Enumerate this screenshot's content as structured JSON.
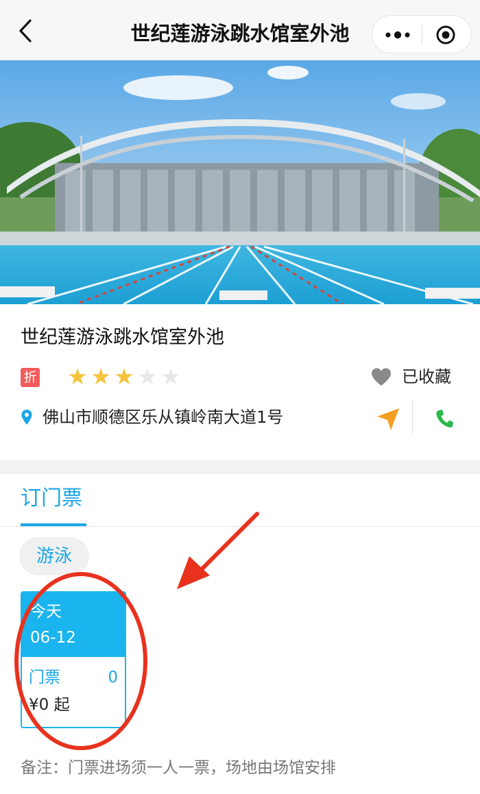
{
  "header": {
    "title": "世纪莲游泳跳水馆室外池",
    "back_icon": "chevron-left-icon",
    "more_icon": "more-dots-icon",
    "target_icon": "target-icon"
  },
  "photo": {
    "subject": "outdoor-swimming-pool-with-arched-roof"
  },
  "venue": {
    "name": "世纪莲游泳跳水馆室外池",
    "discount_badge": "折",
    "rating": 3,
    "rating_max": 5,
    "favorite_label": "已收藏",
    "address": "佛山市顺德区乐从镇岭南大道1号"
  },
  "tabs": [
    {
      "label": "订门票",
      "active": true
    }
  ],
  "category_chip": "游泳",
  "date_card": {
    "day_label": "今天",
    "date": "06-12",
    "ticket_label": "门票",
    "ticket_count": "0",
    "price": "¥0 起"
  },
  "note": "备注：门票进场须一人一票，场地由场馆安排",
  "colors": {
    "accent": "#1aa6e6",
    "card_blue": "#1ab4ee",
    "star": "#f5c33b",
    "discount_red": "#f25b5b",
    "nav_orange": "#f5a020",
    "call_green": "#2db84d",
    "annotation_red": "#e8321e"
  }
}
